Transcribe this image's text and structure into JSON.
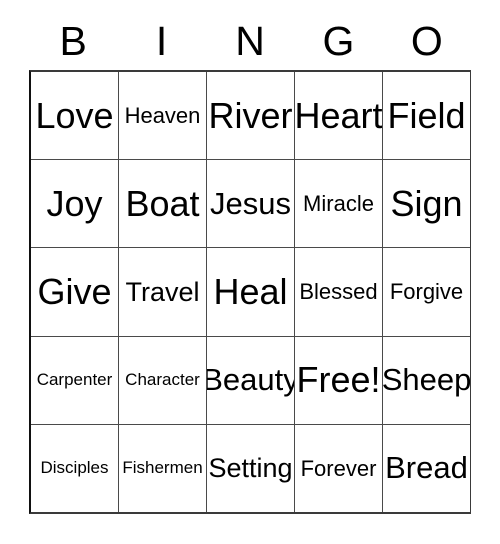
{
  "card": {
    "header_letters": [
      "B",
      "I",
      "N",
      "G",
      "O"
    ],
    "columns": [
      {
        "letter": "B",
        "cells": [
          {
            "text": "Love",
            "size": "len-xl"
          },
          {
            "text": "Joy",
            "size": "len-xl"
          },
          {
            "text": "Give",
            "size": "len-xl"
          },
          {
            "text": "Carpenter",
            "size": "len-xs"
          },
          {
            "text": "Disciples",
            "size": "len-xs"
          }
        ]
      },
      {
        "letter": "I",
        "cells": [
          {
            "text": "Heaven",
            "size": "len-sm"
          },
          {
            "text": "Boat",
            "size": "len-xl"
          },
          {
            "text": "Travel",
            "size": "len-md"
          },
          {
            "text": "Character",
            "size": "len-xs"
          },
          {
            "text": "Fishermen",
            "size": "len-xs"
          }
        ]
      },
      {
        "letter": "N",
        "cells": [
          {
            "text": "River",
            "size": "len-xl"
          },
          {
            "text": "Jesus",
            "size": "len-lg"
          },
          {
            "text": "Heal",
            "size": "len-xl"
          },
          {
            "text": "Beauty",
            "size": "len-lg"
          },
          {
            "text": "Setting",
            "size": "len-md"
          }
        ]
      },
      {
        "letter": "G",
        "cells": [
          {
            "text": "Heart",
            "size": "len-xl"
          },
          {
            "text": "Miracle",
            "size": "len-sm"
          },
          {
            "text": "Blessed",
            "size": "len-sm"
          },
          {
            "text": "Free!",
            "size": "len-xl"
          },
          {
            "text": "Forever",
            "size": "len-sm"
          }
        ]
      },
      {
        "letter": "O",
        "cells": [
          {
            "text": "Field",
            "size": "len-xl"
          },
          {
            "text": "Sign",
            "size": "len-xl"
          },
          {
            "text": "Forgive",
            "size": "len-sm"
          },
          {
            "text": "Sheep",
            "size": "len-lg"
          },
          {
            "text": "Bread",
            "size": "len-lg"
          }
        ]
      }
    ],
    "rows": [
      [
        {
          "text": "Love",
          "size": "len-xl"
        },
        {
          "text": "Heaven",
          "size": "len-sm"
        },
        {
          "text": "River",
          "size": "len-xl"
        },
        {
          "text": "Heart",
          "size": "len-xl"
        },
        {
          "text": "Field",
          "size": "len-xl"
        }
      ],
      [
        {
          "text": "Joy",
          "size": "len-xl"
        },
        {
          "text": "Boat",
          "size": "len-xl"
        },
        {
          "text": "Jesus",
          "size": "len-lg"
        },
        {
          "text": "Miracle",
          "size": "len-sm"
        },
        {
          "text": "Sign",
          "size": "len-xl"
        }
      ],
      [
        {
          "text": "Give",
          "size": "len-xl"
        },
        {
          "text": "Travel",
          "size": "len-md"
        },
        {
          "text": "Heal",
          "size": "len-xl"
        },
        {
          "text": "Blessed",
          "size": "len-sm"
        },
        {
          "text": "Forgive",
          "size": "len-sm"
        }
      ],
      [
        {
          "text": "Carpenter",
          "size": "len-xs"
        },
        {
          "text": "Character",
          "size": "len-xs"
        },
        {
          "text": "Beauty",
          "size": "len-lg"
        },
        {
          "text": "Free!",
          "size": "len-xl"
        },
        {
          "text": "Sheep",
          "size": "len-lg"
        }
      ],
      [
        {
          "text": "Disciples",
          "size": "len-xs"
        },
        {
          "text": "Fishermen",
          "size": "len-xs"
        },
        {
          "text": "Setting",
          "size": "len-md"
        },
        {
          "text": "Forever",
          "size": "len-sm"
        },
        {
          "text": "Bread",
          "size": "len-lg"
        }
      ]
    ],
    "free_space": {
      "row": 3,
      "column": 3,
      "text": "Free!"
    },
    "colors": {
      "background": "#ffffff",
      "text": "#000000",
      "grid_line": "#4a4a4a",
      "outer_border": "#3a3a3a"
    }
  }
}
